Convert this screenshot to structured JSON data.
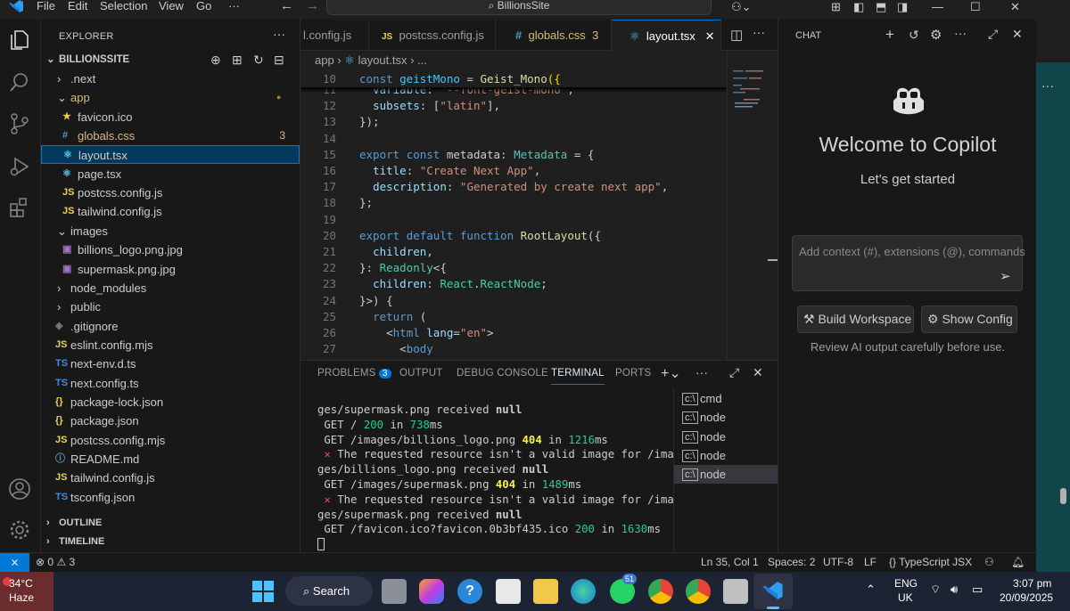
{
  "titlebar": {
    "menu": [
      "File",
      "Edit",
      "Selection",
      "View",
      "Go",
      "···"
    ],
    "search": "BillionsSite"
  },
  "sidebar": {
    "header": "EXPLORER",
    "project": "BILLIONSSITE",
    "items": [
      {
        "label": ".next",
        "type": "folder-closed"
      },
      {
        "label": "app",
        "type": "folder-open"
      },
      {
        "label": "favicon.ico",
        "type": "star",
        "icon": "★"
      },
      {
        "label": "globals.css",
        "type": "css",
        "icon": "#",
        "badge": "3"
      },
      {
        "label": "layout.tsx",
        "type": "react",
        "icon": "⚛"
      },
      {
        "label": "page.tsx",
        "type": "react",
        "icon": "⚛"
      },
      {
        "label": "postcss.config.js",
        "type": "js",
        "icon": "JS"
      },
      {
        "label": "tailwind.config.js",
        "type": "js",
        "icon": "JS"
      },
      {
        "label": "images",
        "type": "folder-open"
      },
      {
        "label": "billions_logo.png.jpg",
        "type": "image",
        "icon": "▣"
      },
      {
        "label": "supermask.png.jpg",
        "type": "image",
        "icon": "▣"
      },
      {
        "label": "node_modules",
        "type": "folder-closed"
      },
      {
        "label": "public",
        "type": "folder-closed"
      },
      {
        "label": ".gitignore",
        "type": "git",
        "icon": "◈"
      },
      {
        "label": "eslint.config.mjs",
        "type": "js",
        "icon": "JS"
      },
      {
        "label": "next-env.d.ts",
        "type": "ts",
        "icon": "TS"
      },
      {
        "label": "next.config.ts",
        "type": "ts",
        "icon": "TS"
      },
      {
        "label": "package-lock.json",
        "type": "json",
        "icon": "{}"
      },
      {
        "label": "package.json",
        "type": "json",
        "icon": "{}"
      },
      {
        "label": "postcss.config.mjs",
        "type": "js",
        "icon": "JS"
      },
      {
        "label": "README.md",
        "type": "md",
        "icon": "ⓘ"
      },
      {
        "label": "tailwind.config.js",
        "type": "js",
        "icon": "JS"
      },
      {
        "label": "tsconfig.json",
        "type": "tsconfig",
        "icon": "TS"
      }
    ],
    "outline": "OUTLINE",
    "timeline": "TIMELINE"
  },
  "tabs": [
    {
      "label": "l.config.js",
      "icon": ""
    },
    {
      "label": "postcss.config.js",
      "icon": "JS"
    },
    {
      "label": "globals.css",
      "icon": "#",
      "badge": "3"
    },
    {
      "label": "layout.tsx",
      "icon": "⚛",
      "close": "✕"
    }
  ],
  "breadcrumb": {
    "folder": "app",
    "sep": "›",
    "file": "layout.tsx",
    "more": "› ..."
  },
  "code": {
    "sticky": {
      "num": "10",
      "text": "const geistMono = Geist_Mono({"
    },
    "lines": [
      {
        "num": "11",
        "text": "  variable: \"--font-geist-mono\","
      },
      {
        "num": "12",
        "text": "  subsets: [\"latin\"],"
      },
      {
        "num": "13",
        "text": "});"
      },
      {
        "num": "14",
        "text": ""
      },
      {
        "num": "15",
        "text": "export const metadata: Metadata = {"
      },
      {
        "num": "16",
        "text": "  title: \"Create Next App\","
      },
      {
        "num": "17",
        "text": "  description: \"Generated by create next app\","
      },
      {
        "num": "18",
        "text": "};"
      },
      {
        "num": "19",
        "text": ""
      },
      {
        "num": "20",
        "text": "export default function RootLayout({"
      },
      {
        "num": "21",
        "text": "  children,"
      },
      {
        "num": "22",
        "text": "}: Readonly<{"
      },
      {
        "num": "23",
        "text": "  children: React.ReactNode;"
      },
      {
        "num": "24",
        "text": "}>) {"
      },
      {
        "num": "25",
        "text": "  return ("
      },
      {
        "num": "26",
        "text": "    <html lang=\"en\">"
      },
      {
        "num": "27",
        "text": "      <body"
      }
    ]
  },
  "panel": {
    "tabs": {
      "problems": "PROBLEMS",
      "problems_count": "3",
      "output": "OUTPUT",
      "debug": "DEBUG CONSOLE",
      "terminal": "TERMINAL",
      "ports": "PORTS"
    },
    "terminal_lines": [
      "ges/supermask.png received null",
      " GET / 200 in 738ms",
      " GET /images/billions_logo.png 404 in 1216ms",
      " ✕ The requested resource isn't a valid image for /ima",
      "ges/billions_logo.png received null",
      " GET /images/supermask.png 404 in 1489ms",
      " ✕ The requested resource isn't a valid image for /ima",
      "ges/supermask.png received null",
      " GET /favicon.ico?favicon.0b3bf435.ico 200 in 1630ms"
    ],
    "terminals": [
      "cmd",
      "node",
      "node",
      "node",
      "node"
    ]
  },
  "chat": {
    "header": "CHAT",
    "welcome": "Welcome to Copilot",
    "subtitle": "Let's get started",
    "input_placeholder": "Add context (#), extensions (@), commands",
    "build_button": "Build Workspace",
    "config_button": "Show Config",
    "disclaimer": "Review AI output carefully before use."
  },
  "statusbar": {
    "errors": "0",
    "warnings": "3",
    "position": "Ln 35, Col 1",
    "spaces": "Spaces: 2",
    "encoding": "UTF-8",
    "eol": "LF",
    "language": "TypeScript JSX"
  },
  "taskbar": {
    "weather_temp": "34°C",
    "weather_desc": "Haze",
    "search": "Search",
    "lang1": "ENG",
    "lang2": "UK",
    "time": "3:07 pm",
    "date": "20/09/2025",
    "whatsapp_badge": "51"
  },
  "colors": {
    "accent": "#0078d4",
    "warning": "#d7ba7d",
    "keyword": "#569cd6",
    "string": "#ce9178",
    "type": "#4ec9b0"
  }
}
